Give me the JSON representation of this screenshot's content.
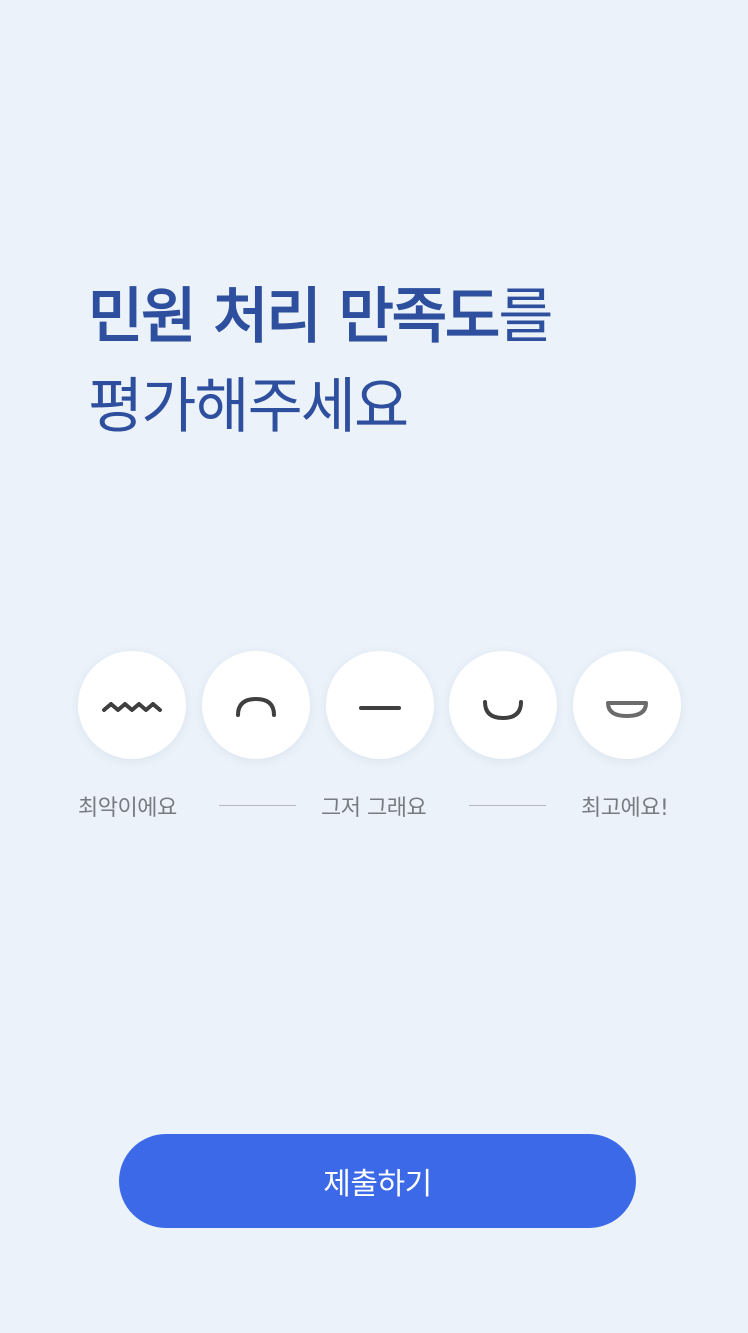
{
  "colors": {
    "background": "#ebf2fa",
    "heading": "#2e4f9e",
    "accent": "#3b69e8",
    "label": "#777b82"
  },
  "headline": {
    "line1_bold": "민원 처리 만족도",
    "line1_light": "를",
    "line2": "평가해주세요"
  },
  "rating": {
    "options": [
      {
        "icon": "squiggle-mouth-icon",
        "meaning": "worst"
      },
      {
        "icon": "frown-mouth-icon",
        "meaning": "bad"
      },
      {
        "icon": "flat-mouth-icon",
        "meaning": "neutral"
      },
      {
        "icon": "smile-mouth-icon",
        "meaning": "good"
      },
      {
        "icon": "grin-mouth-icon",
        "meaning": "best"
      }
    ],
    "labels": {
      "low": "최악이에요",
      "mid": "그저 그래요",
      "high": "최고에요!"
    }
  },
  "submit": {
    "label": "제출하기"
  }
}
